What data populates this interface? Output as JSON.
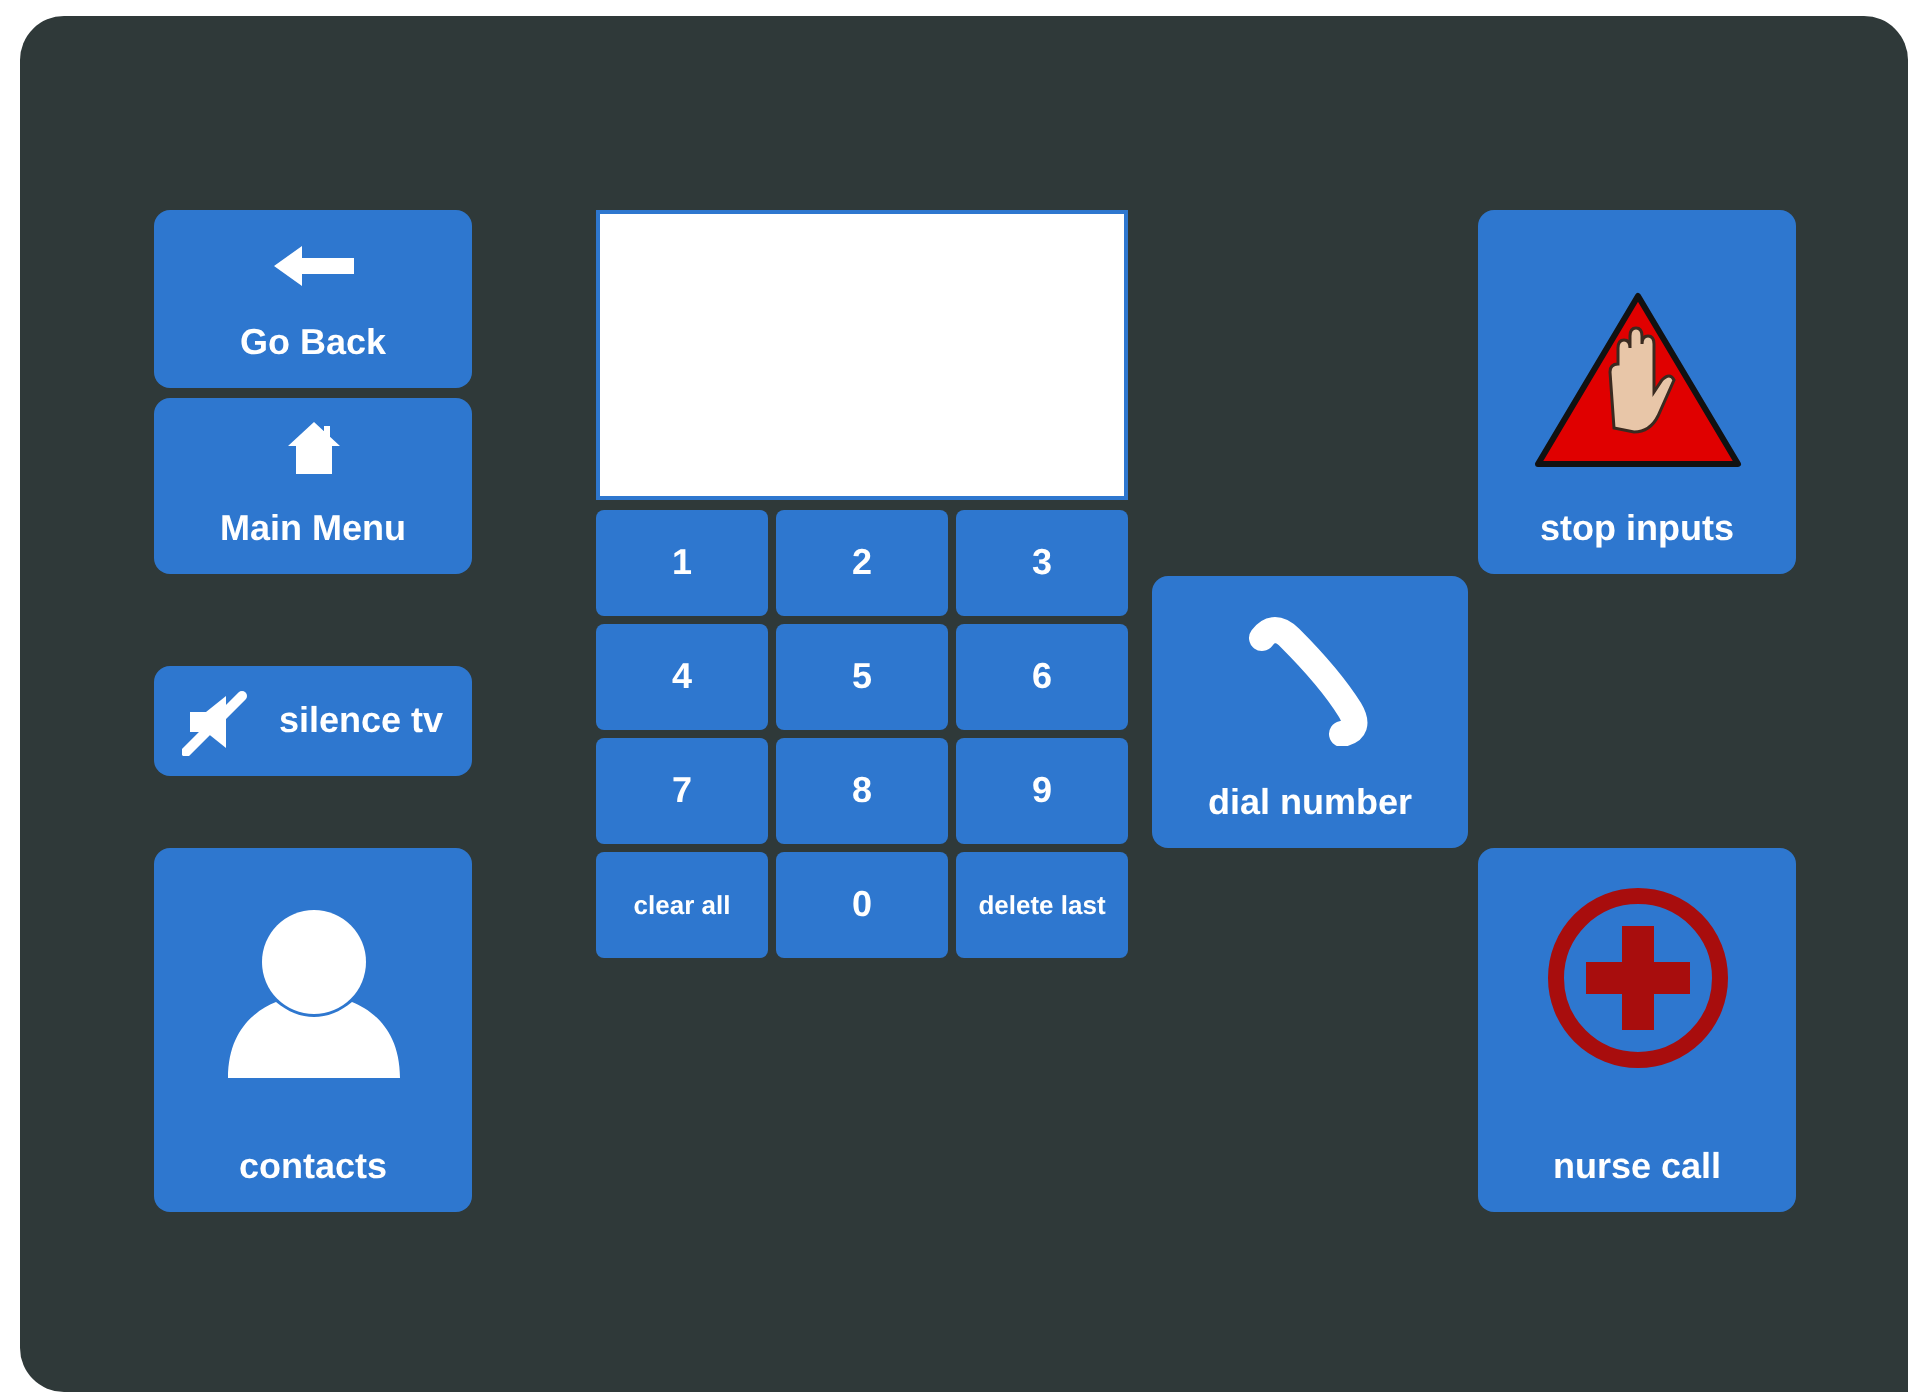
{
  "left_buttons": [
    {
      "label": "Go Back",
      "kind": "back"
    },
    {
      "label": "Main Menu",
      "kind": "home"
    },
    {
      "label": "silence tv",
      "kind": "mute"
    },
    {
      "label": "contacts",
      "kind": "contact"
    }
  ],
  "keypad": [
    "1",
    "2",
    "3",
    "4",
    "5",
    "6",
    "7",
    "8",
    "9",
    "clear all",
    "0",
    "delete last"
  ],
  "dial_button": {
    "label": "dial number",
    "kind": "dial"
  },
  "right_buttons": [
    {
      "label": "stop inputs",
      "kind": "stop"
    },
    {
      "label": "nurse call",
      "kind": "nurse"
    }
  ]
}
